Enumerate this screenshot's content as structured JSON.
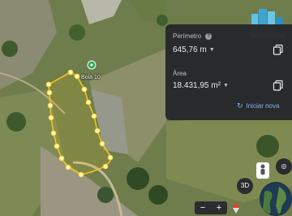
{
  "measure_panel": {
    "perimeter_label": "Perímetro",
    "perimeter_value": "645,76 m",
    "area_label": "Área",
    "area_value": "18.431,95 m²",
    "reset_label": "Iniciar nova"
  },
  "map": {
    "pin_label": "Bola 10",
    "button_3d": "3D",
    "zoom_out": "−",
    "zoom_in": "+"
  },
  "colors": {
    "polygon_stroke": "#f2c31a",
    "vertex_fill": "#fff6b0",
    "panel_bg": "#26272a",
    "accent": "#8ab4f8",
    "pin_green": "#34a853"
  },
  "icons": [
    "help-icon",
    "copy-icon",
    "reset-icon",
    "map-pin-icon",
    "pegman-icon",
    "location-icon",
    "compass-icon",
    "globe-icon",
    "logo-icon"
  ]
}
